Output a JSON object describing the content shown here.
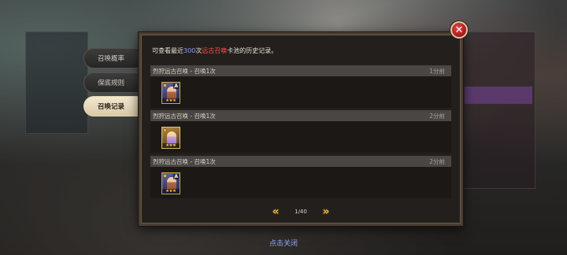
{
  "tabs": [
    {
      "label": "召唤概率",
      "active": false
    },
    {
      "label": "保底规则",
      "active": false
    },
    {
      "label": "召唤记录",
      "active": true
    }
  ],
  "intro": {
    "prefix": "可查看最近",
    "count": "300",
    "count_suffix": "次",
    "pool": "远古召唤",
    "suffix": "卡池的历史记录。",
    "count_color": "#8fa2ff",
    "pool_color": "#ff4d4d"
  },
  "records": [
    {
      "title": "烈狩远古召唤 - 召唤1次",
      "time": "1分前",
      "hero": {
        "rank": "A",
        "frame": "blue"
      }
    },
    {
      "title": "烈狩远古召唤 - 召唤1次",
      "time": "2分前",
      "hero": {
        "rank": "",
        "frame": "gold"
      }
    },
    {
      "title": "烈狩远古召唤 - 召唤1次",
      "time": "2分前",
      "hero": {
        "rank": "A",
        "frame": "blue"
      }
    }
  ],
  "pager": {
    "page_text": "1/40",
    "prev_icon": "double-chevron-left-icon",
    "next_icon": "double-chevron-right-icon"
  },
  "close_icon": "close-icon",
  "close_hint": "点击关闭"
}
